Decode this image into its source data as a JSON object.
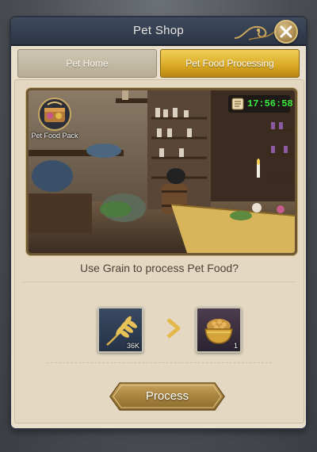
{
  "window": {
    "title": "Pet Shop"
  },
  "tabs": [
    {
      "label": "Pet Home",
      "active": false
    },
    {
      "label": "Pet Food Processing",
      "active": true
    }
  ],
  "scene": {
    "timer": "17:56:58",
    "pack_label": "Pet Food Pack"
  },
  "prompt": "Use Grain to process Pet Food?",
  "conversion": {
    "input": {
      "item": "grain",
      "icon": "wheat-icon",
      "count": "36K"
    },
    "output": {
      "item": "pet food",
      "icon": "pet-food-bowl-icon",
      "count": "1"
    }
  },
  "actions": {
    "process_label": "Process"
  },
  "colors": {
    "accent_gold": "#d9a824",
    "timer_green": "#3bea3b",
    "header_blue": "#2c3546"
  }
}
